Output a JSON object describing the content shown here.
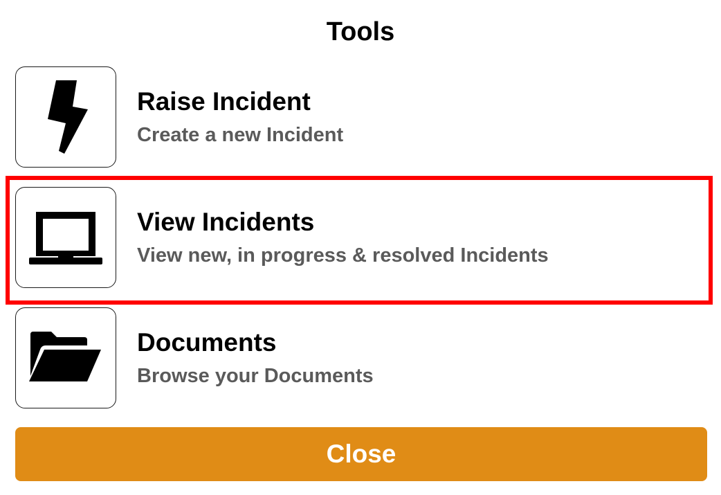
{
  "header": {
    "title": "Tools"
  },
  "tools": [
    {
      "title": "Raise Incident",
      "subtitle": "Create a new Incident",
      "icon": "lightning-bolt-icon"
    },
    {
      "title": "View Incidents",
      "subtitle": "View new, in progress & resolved Incidents",
      "icon": "laptop-icon",
      "highlighted": true
    },
    {
      "title": "Documents",
      "subtitle": "Browse your Documents",
      "icon": "folder-open-icon"
    }
  ],
  "footer": {
    "close_label": "Close"
  },
  "colors": {
    "accent": "#e08c16",
    "highlight": "#ff0000",
    "subtitle": "#5a5a5a"
  }
}
